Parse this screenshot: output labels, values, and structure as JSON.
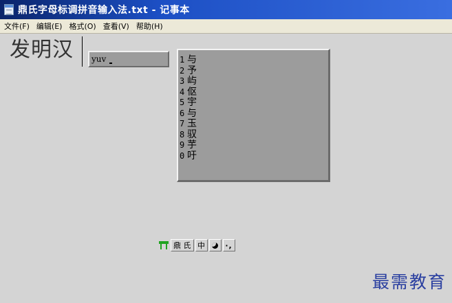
{
  "window": {
    "title": "鼎氏字母标调拼音输入法.txt - 记事本"
  },
  "menu": {
    "items": [
      "文件(F)",
      "编辑(E)",
      "格式(O)",
      "查看(V)",
      "帮助(H)"
    ]
  },
  "editor": {
    "text": "发明汉"
  },
  "ime": {
    "composition": "yuv",
    "candidates": [
      {
        "num": "1",
        "char": "与"
      },
      {
        "num": "2",
        "char": "予"
      },
      {
        "num": "3",
        "char": "屿"
      },
      {
        "num": "4",
        "char": "伛"
      },
      {
        "num": "5",
        "char": "宇"
      },
      {
        "num": "6",
        "char": "与"
      },
      {
        "num": "7",
        "char": "玉"
      },
      {
        "num": "8",
        "char": "驭"
      },
      {
        "num": "9",
        "char": "芋"
      },
      {
        "num": "0",
        "char": "吁"
      }
    ],
    "toolbar": {
      "name": "鼎 氏",
      "mode": "中",
      "punct": "·,"
    }
  },
  "watermark": "最需教育",
  "icons": [
    "notepad-icon",
    "ime-logo-icon",
    "half-width-moon-icon"
  ]
}
